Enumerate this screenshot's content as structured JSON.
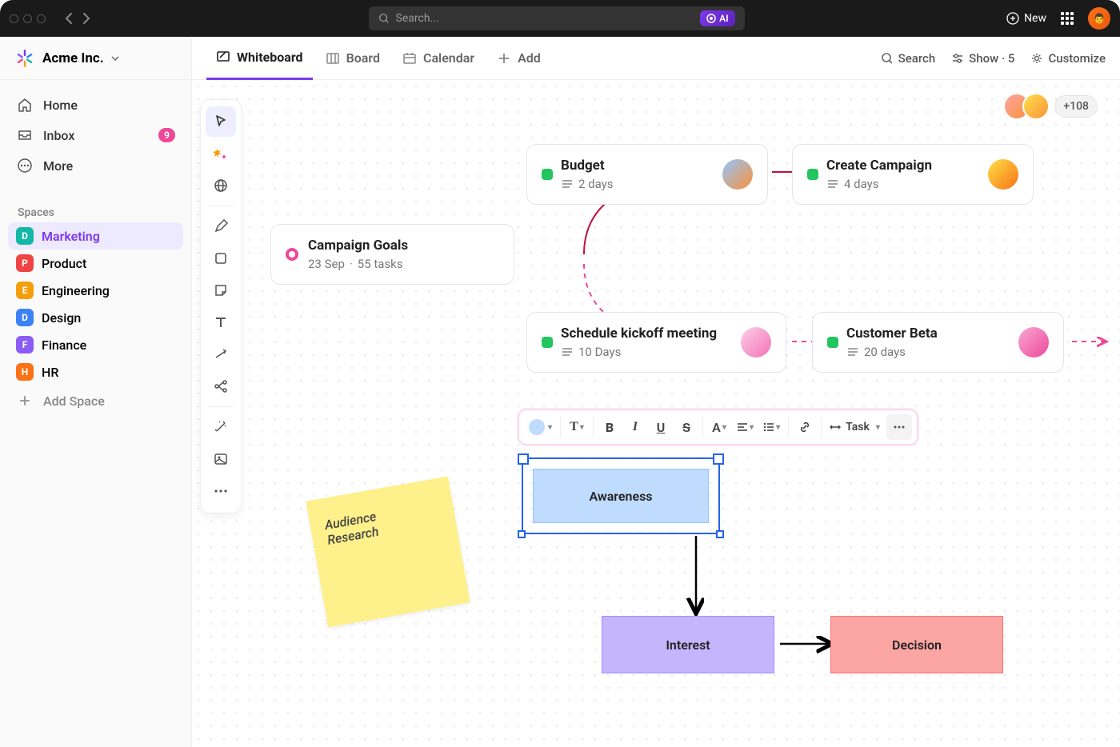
{
  "topbar": {
    "search_placeholder": "Search...",
    "ai_label": "AI",
    "new_label": "New"
  },
  "workspace": {
    "name": "Acme Inc."
  },
  "nav": {
    "home": "Home",
    "inbox": "Inbox",
    "inbox_count": "9",
    "more": "More",
    "spaces_label": "Spaces",
    "add_space": "Add Space"
  },
  "spaces": [
    {
      "initial": "D",
      "name": "Marketing",
      "color": "#14b8a6",
      "active": true
    },
    {
      "initial": "P",
      "name": "Product",
      "color": "#ef4444"
    },
    {
      "initial": "E",
      "name": "Engineering",
      "color": "#f59e0b"
    },
    {
      "initial": "D",
      "name": "Design",
      "color": "#3b82f6"
    },
    {
      "initial": "F",
      "name": "Finance",
      "color": "#8b5cf6"
    },
    {
      "initial": "H",
      "name": "HR",
      "color": "#f97316"
    }
  ],
  "tabs": {
    "whiteboard": "Whiteboard",
    "board": "Board",
    "calendar": "Calendar",
    "add": "Add",
    "search": "Search",
    "show": "Show · 5",
    "customize": "Customize"
  },
  "presence": {
    "extra": "+108"
  },
  "nodes": {
    "goals": {
      "title": "Campaign Goals",
      "date": "23 Sep",
      "tasks": "55 tasks"
    },
    "budget": {
      "title": "Budget",
      "subtitle": "2 days"
    },
    "create": {
      "title": "Create Campaign",
      "subtitle": "4 days"
    },
    "kickoff": {
      "title": "Schedule kickoff meeting",
      "subtitle": "10 Days"
    },
    "beta": {
      "title": "Customer Beta",
      "subtitle": "20 days"
    }
  },
  "sticky": {
    "line1": "Audience",
    "line2": "Research"
  },
  "shapes": {
    "awareness": "Awareness",
    "interest": "Interest",
    "decision": "Decision"
  },
  "ftoolbar": {
    "task": "Task"
  }
}
